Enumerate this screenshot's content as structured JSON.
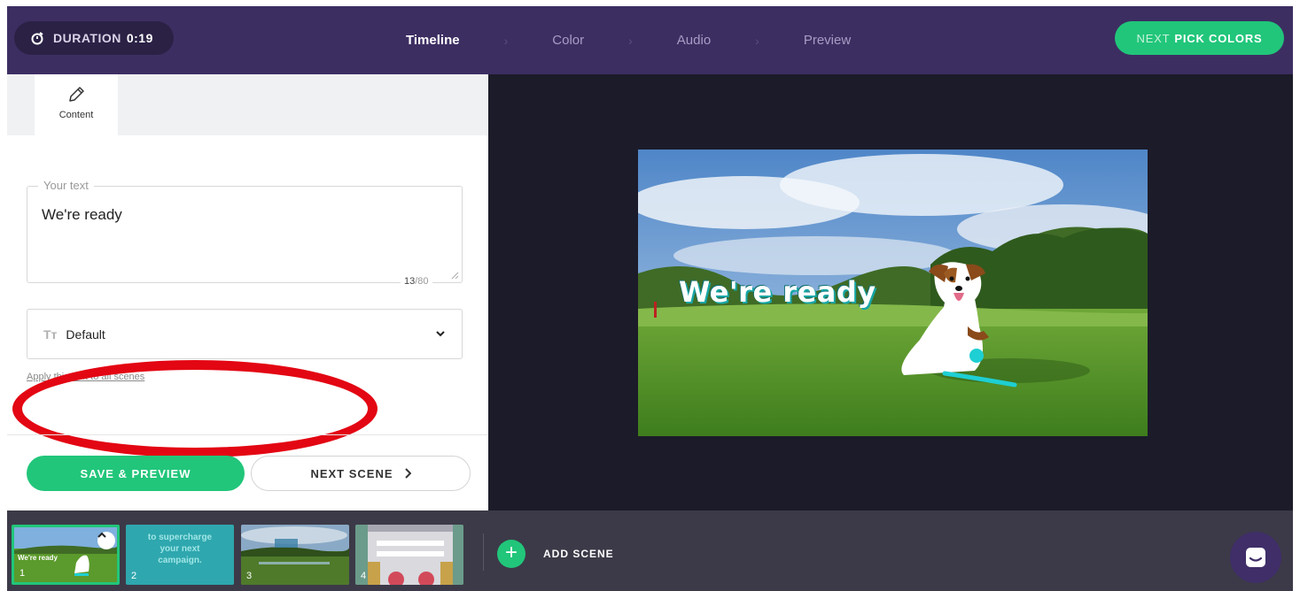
{
  "header": {
    "duration_label": "DURATION",
    "duration_value": "0:19",
    "steps": [
      {
        "label": "Timeline",
        "active": true
      },
      {
        "label": "Color",
        "active": false
      },
      {
        "label": "Audio",
        "active": false
      },
      {
        "label": "Preview",
        "active": false
      }
    ],
    "next_prefix": "NEXT",
    "next_label": "PICK COLORS"
  },
  "left_panel": {
    "tab_label": "Content",
    "text_field": {
      "legend": "Your text",
      "value": "We're ready",
      "count": "13",
      "max": "/80"
    },
    "font_select": {
      "icon": "Tт",
      "value": "Default"
    },
    "apply_link": "Apply this font to all scenes",
    "save_button": "SAVE & PREVIEW",
    "next_scene_button": "NEXT SCENE"
  },
  "preview": {
    "caption": "We're ready"
  },
  "scene_strip": {
    "thumbs": [
      {
        "number": "1",
        "caption": "We're ready"
      },
      {
        "number": "2",
        "caption_lines": [
          "to supercharge",
          "your next",
          "campaign."
        ]
      },
      {
        "number": "3"
      },
      {
        "number": "4"
      }
    ],
    "add_scene_label": "ADD SCENE"
  },
  "colors": {
    "header_bg": "#3d2e62",
    "accent_green": "#21c67a",
    "preview_bg": "#1c1b29",
    "strip_bg": "#3c3a48",
    "annotation_red": "#e30613"
  }
}
